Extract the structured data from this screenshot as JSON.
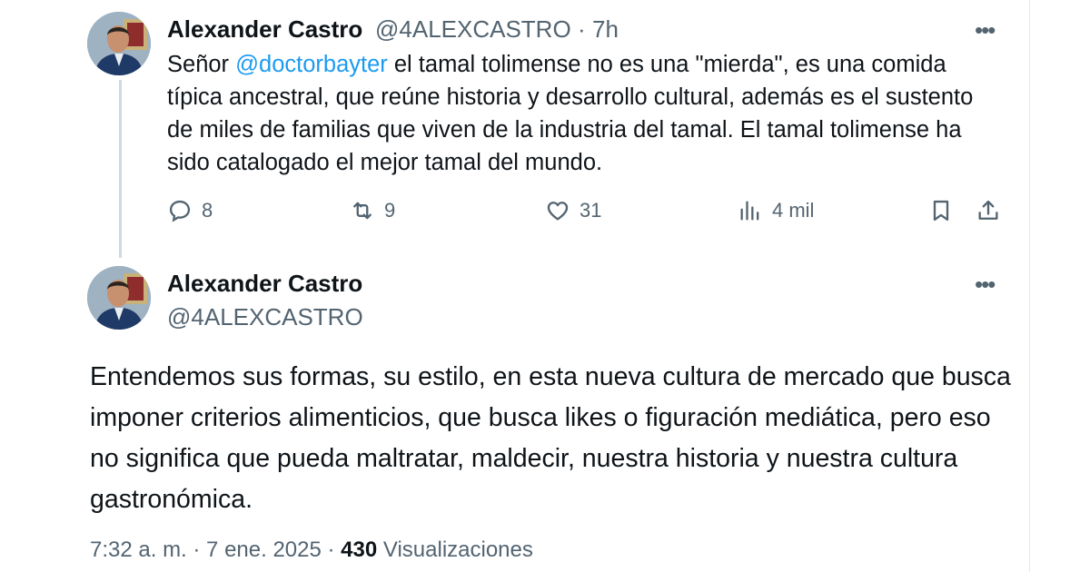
{
  "tweet1": {
    "author_name": "Alexander Castro",
    "handle": "@4ALEXCASTRO",
    "time_separator": "·",
    "time": "7h",
    "more": "•••",
    "text_prefix": "Señor ",
    "mention": "@doctorbayter",
    "text_suffix": " el tamal tolimense no es una \"mierda\", es una comida típica ancestral, que reúne historia y desarrollo cultural, además es el sustento de miles de familias que viven de la industria del tamal. El tamal tolimense ha sido catalogado el mejor tamal del mundo.",
    "replies": "8",
    "reposts": "9",
    "likes": "31",
    "views": "4 mil"
  },
  "tweet2": {
    "author_name": "Alexander Castro",
    "handle": "@4ALEXCASTRO",
    "more": "•••",
    "text": "Entendemos sus formas, su estilo, en esta nueva cultura de mercado que busca imponer criterios alimenticios, que busca likes o figuración mediática, pero eso no significa que pueda maltratar, maldecir, nuestra historia y nuestra cultura gastronómica.",
    "timestamp": "7:32 a. m. · 7 ene. 2025 · ",
    "views_count": "430",
    "views_label": " Visualizaciones"
  },
  "colors": {
    "text": "#0f1419",
    "secondary": "#536471",
    "link": "#1d9bf0",
    "thread_line": "#cfd9de"
  },
  "icons": [
    "reply-icon",
    "repost-icon",
    "like-icon",
    "views-icon",
    "bookmark-icon",
    "share-icon",
    "more-icon"
  ]
}
